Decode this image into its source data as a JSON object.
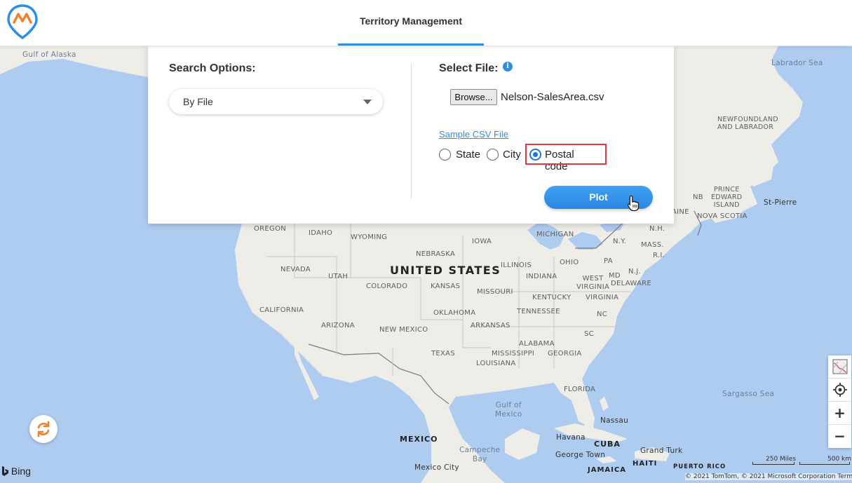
{
  "header": {
    "tab_title": "Territory Management"
  },
  "search_panel": {
    "search_options_heading": "Search Options:",
    "search_option_selected": "By File",
    "select_file_heading": "Select File:",
    "browse_label": "Browse...",
    "file_name": "Nelson-SalesArea.csv",
    "sample_link": "Sample CSV File",
    "radio_options": [
      {
        "label": "State",
        "checked": false
      },
      {
        "label": "City",
        "checked": false
      },
      {
        "label": "Postal code",
        "checked": true
      }
    ],
    "plot_label": "Plot"
  },
  "map": {
    "labels": {
      "gulf_of_alaska": "Gulf of Alaska",
      "labrador_sea": "Labrador Sea",
      "newfoundland": "NEWFOUNDLAND\nAND LABRADOR",
      "united_states": "UNITED STATES",
      "mexico": "MEXICO",
      "gulf_of_mexico": "Gulf of\nMexico",
      "sargasso_sea": "Sargasso Sea",
      "campeche_bay": "Campeche\nBay",
      "cuba": "CUBA",
      "jamaica": "JAMAICA",
      "haiti": "HAITI",
      "puerto_rico": "PUERTO RICO",
      "prince_edward_island": "PRINCE\nEDWARD\nISLAND",
      "nova_scotia": "NOVA SCOTIA",
      "nb": "NB",
      "st_pierre": "St-Pierre",
      "oregon": "OREGON",
      "idaho": "IDAHO",
      "wyoming": "WYOMING",
      "nebraska": "NEBRASKA",
      "iowa": "IOWA",
      "michigan": "MICHIGAN",
      "nevada": "NEVADA",
      "utah": "UTAH",
      "colorado": "COLORADO",
      "kansas": "KANSAS",
      "missouri": "MISSOURI",
      "illinois": "ILLINOIS",
      "indiana": "INDIANA",
      "ohio": "OHIO",
      "pa": "PA",
      "ny": "N.Y.",
      "nh": "N.H.",
      "mass": "MASS.",
      "ri": "R.I.",
      "nj": "N.J.",
      "md": "MD",
      "delaware": "DELAWARE",
      "west_virginia": "WEST\nVIRGINIA",
      "virginia": "VIRGINIA",
      "kentucky": "KENTUCKY",
      "tennessee": "TENNESSEE",
      "nc": "NC",
      "sc": "SC",
      "california": "CALIFORNIA",
      "arizona": "ARIZONA",
      "new_mexico": "NEW MEXICO",
      "oklahoma": "OKLAHOMA",
      "arkansas": "ARKANSAS",
      "texas": "TEXAS",
      "mississippi": "MISSISSIPPI",
      "alabama": "ALABAMA",
      "georgia": "GEORGIA",
      "louisiana": "LOUISIANA",
      "florida": "FLORIDA",
      "nassau": "Nassau",
      "havana": "Havana",
      "george_town": "George Town",
      "grand_turk": "Grand Turk",
      "mexico_city": "Mexico City",
      "maine_partial": "AINE"
    },
    "bing_label": "Bing",
    "scale_miles": "250 Miles",
    "scale_km": "500 km",
    "copyright": "© 2021 TomTom, © 2021 Microsoft Corporation  Terms"
  },
  "controls": {
    "zoom_in": "+",
    "zoom_out": "−"
  },
  "colors": {
    "accent": "#2b8ee8",
    "highlight": "#e0393e",
    "water": "#aecbf0",
    "land": "#efede8"
  }
}
